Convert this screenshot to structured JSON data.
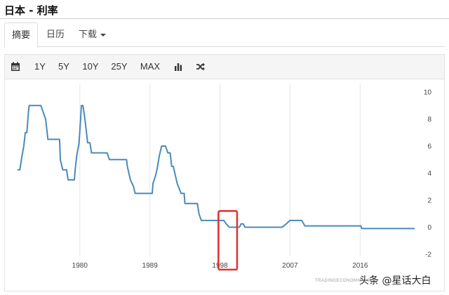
{
  "page": {
    "title": "日本 - 利率"
  },
  "tabs": [
    {
      "label": "摘要",
      "active": true
    },
    {
      "label": "日历",
      "active": false
    },
    {
      "label": "下载",
      "active": false,
      "has_dropdown": true
    }
  ],
  "toolbar": {
    "calendar_icon": "calendar-icon",
    "ranges": [
      "1Y",
      "5Y",
      "10Y",
      "25Y",
      "MAX"
    ],
    "chart_type_icon": "bar-chart-icon",
    "compare_icon": "shuffle-icon"
  },
  "chart_data": {
    "type": "line",
    "title": "",
    "xlabel": "",
    "ylabel": "",
    "x_tick_labels": [
      "1980",
      "1989",
      "1998",
      "2007",
      "2016"
    ],
    "y_tick_labels": [
      "10",
      "8",
      "6",
      "4",
      "2",
      "0",
      "-2"
    ],
    "xlim": [
      1972,
      2023
    ],
    "ylim": [
      -2,
      10
    ],
    "y_axis_side": "right",
    "grid": "vertical",
    "line_color": "#4a8ab9",
    "highlight_box_color": "#e03030",
    "highlight_x_range": [
      1997.8,
      2000.2
    ],
    "highlight_y_range": [
      -2.1,
      1.2
    ],
    "series": [
      {
        "points": [
          [
            1972.0,
            4.25
          ],
          [
            1972.3,
            4.25
          ],
          [
            1972.5,
            5.0
          ],
          [
            1972.8,
            6.0
          ],
          [
            1973.0,
            7.0
          ],
          [
            1973.2,
            7.0
          ],
          [
            1973.4,
            8.5
          ],
          [
            1973.5,
            9.0
          ],
          [
            1974.0,
            9.0
          ],
          [
            1975.0,
            9.0
          ],
          [
            1975.3,
            8.5
          ],
          [
            1975.6,
            8.0
          ],
          [
            1975.9,
            6.5
          ],
          [
            1976.5,
            6.5
          ],
          [
            1977.0,
            6.5
          ],
          [
            1977.4,
            6.5
          ],
          [
            1977.5,
            5.0
          ],
          [
            1977.8,
            4.25
          ],
          [
            1978.3,
            4.25
          ],
          [
            1978.5,
            3.5
          ],
          [
            1979.0,
            3.5
          ],
          [
            1979.3,
            3.5
          ],
          [
            1979.4,
            4.25
          ],
          [
            1979.6,
            5.25
          ],
          [
            1979.9,
            6.25
          ],
          [
            1980.1,
            8.0
          ],
          [
            1980.2,
            9.0
          ],
          [
            1980.4,
            9.0
          ],
          [
            1980.6,
            8.25
          ],
          [
            1980.8,
            7.25
          ],
          [
            1981.0,
            6.25
          ],
          [
            1981.3,
            6.25
          ],
          [
            1981.5,
            5.5
          ],
          [
            1982.0,
            5.5
          ],
          [
            1983.0,
            5.5
          ],
          [
            1983.5,
            5.5
          ],
          [
            1983.8,
            5.0
          ],
          [
            1984.5,
            5.0
          ],
          [
            1985.5,
            5.0
          ],
          [
            1986.0,
            5.0
          ],
          [
            1986.1,
            4.5
          ],
          [
            1986.3,
            4.0
          ],
          [
            1986.5,
            3.5
          ],
          [
            1986.9,
            3.0
          ],
          [
            1987.1,
            2.5
          ],
          [
            1988.0,
            2.5
          ],
          [
            1989.0,
            2.5
          ],
          [
            1989.3,
            2.5
          ],
          [
            1989.4,
            3.25
          ],
          [
            1989.7,
            3.75
          ],
          [
            1989.9,
            4.25
          ],
          [
            1990.2,
            5.25
          ],
          [
            1990.5,
            6.0
          ],
          [
            1991.0,
            6.0
          ],
          [
            1991.3,
            5.5
          ],
          [
            1991.6,
            5.5
          ],
          [
            1991.8,
            4.5
          ],
          [
            1992.0,
            4.5
          ],
          [
            1992.3,
            3.75
          ],
          [
            1992.5,
            3.25
          ],
          [
            1993.0,
            2.5
          ],
          [
            1993.4,
            2.5
          ],
          [
            1993.5,
            1.75
          ],
          [
            1994.5,
            1.75
          ],
          [
            1995.1,
            1.75
          ],
          [
            1995.3,
            1.0
          ],
          [
            1995.6,
            0.5
          ],
          [
            1996.0,
            0.5
          ],
          [
            1997.0,
            0.5
          ],
          [
            1998.0,
            0.5
          ],
          [
            1998.5,
            0.5
          ],
          [
            1998.8,
            0.25
          ],
          [
            1999.2,
            0.0
          ],
          [
            2000.0,
            0.0
          ],
          [
            2000.5,
            0.0
          ],
          [
            2000.7,
            0.25
          ],
          [
            2001.0,
            0.25
          ],
          [
            2001.2,
            0.0
          ],
          [
            2002.0,
            0.0
          ],
          [
            2004.0,
            0.0
          ],
          [
            2006.0,
            0.0
          ],
          [
            2006.5,
            0.25
          ],
          [
            2007.0,
            0.5
          ],
          [
            2008.0,
            0.5
          ],
          [
            2008.5,
            0.5
          ],
          [
            2008.7,
            0.3
          ],
          [
            2008.9,
            0.1
          ],
          [
            2010.0,
            0.1
          ],
          [
            2012.0,
            0.1
          ],
          [
            2014.0,
            0.1
          ],
          [
            2016.1,
            0.1
          ],
          [
            2016.2,
            -0.1
          ],
          [
            2018.0,
            -0.1
          ],
          [
            2020.0,
            -0.1
          ],
          [
            2023.0,
            -0.1
          ]
        ]
      }
    ]
  },
  "credit": "TRADINGECONOMICS.COM",
  "watermark": "头条 @星话大白"
}
